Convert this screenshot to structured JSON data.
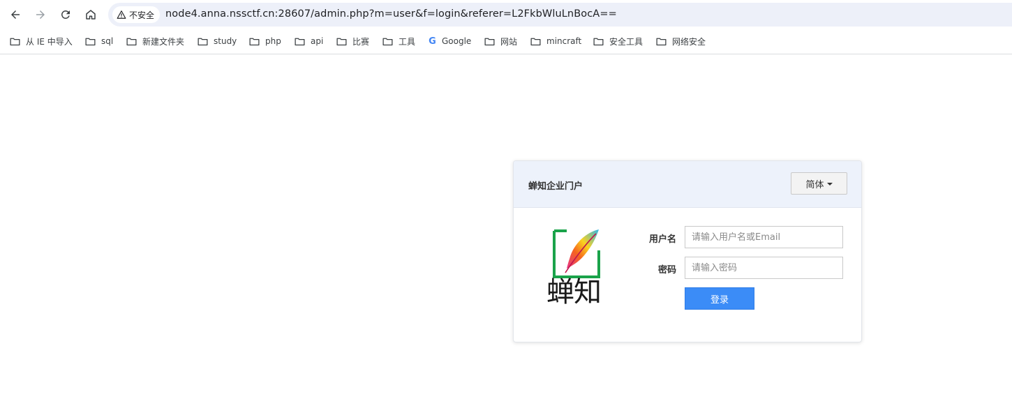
{
  "browser": {
    "security_label": "不安全",
    "url": "node4.anna.nssctf.cn:28607/admin.php?m=user&f=login&referer=L2FkbWluLnBocA=="
  },
  "bookmarks": [
    {
      "label": "从 IE 中导入",
      "icon": "folder-icon"
    },
    {
      "label": "sql",
      "icon": "folder-icon"
    },
    {
      "label": "新建文件夹",
      "icon": "folder-icon"
    },
    {
      "label": "study",
      "icon": "folder-icon"
    },
    {
      "label": "php",
      "icon": "folder-icon"
    },
    {
      "label": "api",
      "icon": "folder-icon"
    },
    {
      "label": "比赛",
      "icon": "folder-icon"
    },
    {
      "label": "工具",
      "icon": "folder-icon"
    },
    {
      "label": "Google",
      "icon": "google-icon"
    },
    {
      "label": "网站",
      "icon": "folder-icon"
    },
    {
      "label": "mincraft",
      "icon": "folder-icon"
    },
    {
      "label": "安全工具",
      "icon": "folder-icon"
    },
    {
      "label": "网络安全",
      "icon": "folder-icon"
    }
  ],
  "login": {
    "title": "蝉知企业门户",
    "language": "简体",
    "logo_text": "蝉知",
    "username_label": "用户名",
    "username_placeholder": "请输入用户名或Email",
    "password_label": "密码",
    "password_placeholder": "请输入密码",
    "submit_label": "登录"
  },
  "colors": {
    "accent": "#3b8cf7",
    "header_bg": "#edf2fb",
    "logo_frame": "#1aa34a"
  }
}
